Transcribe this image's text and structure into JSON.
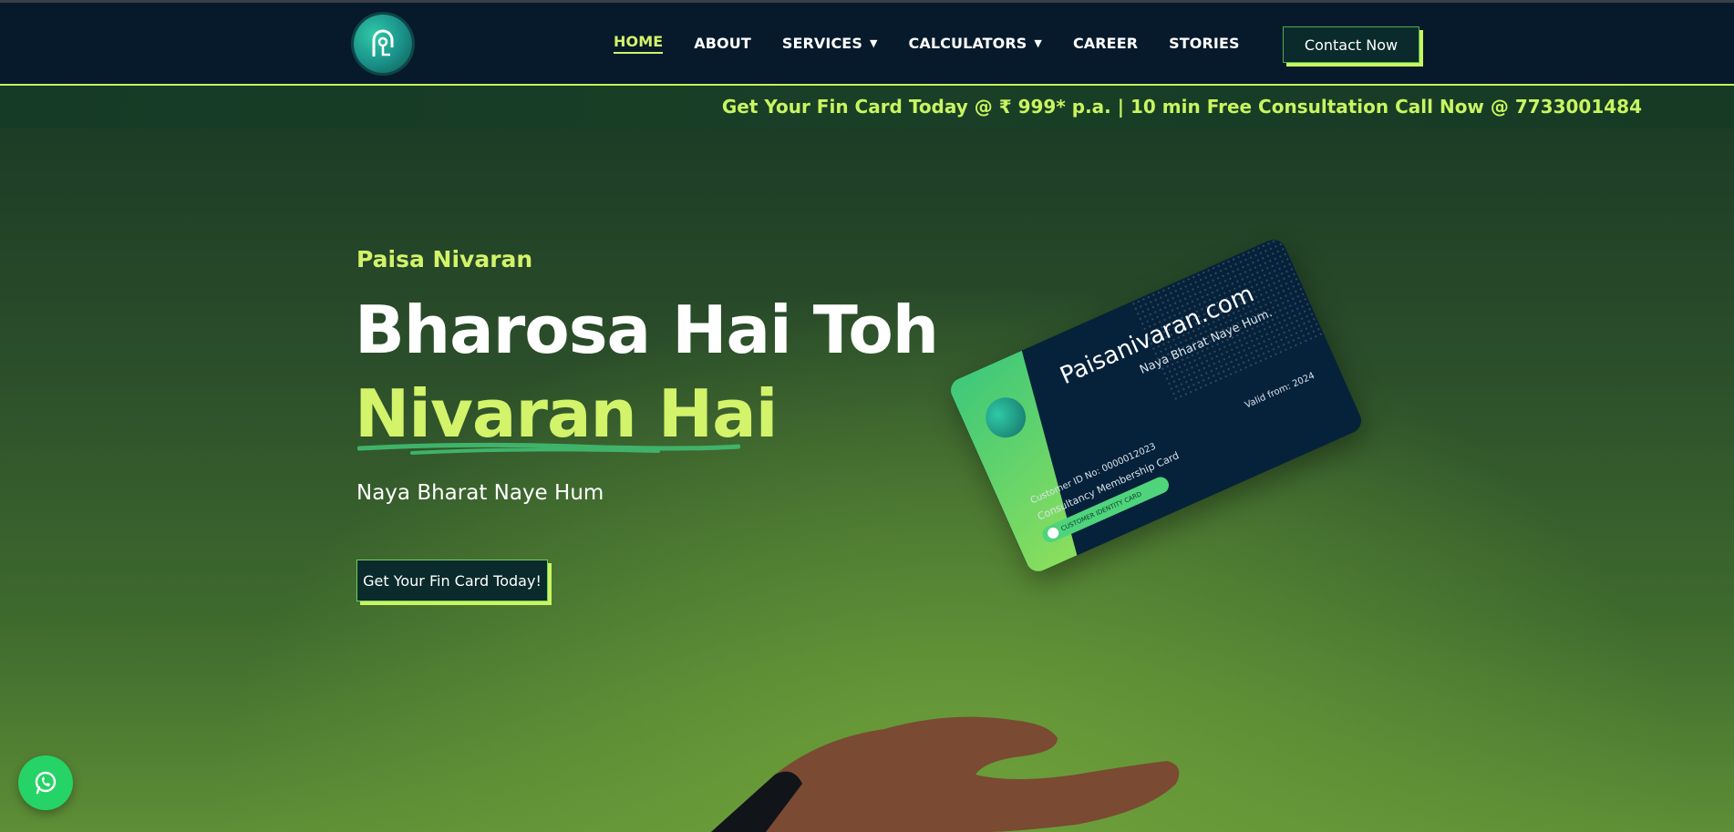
{
  "nav": {
    "items": [
      {
        "label": "HOME",
        "active": true,
        "dropdown": false
      },
      {
        "label": "ABOUT",
        "active": false,
        "dropdown": false
      },
      {
        "label": "SERVICES",
        "active": false,
        "dropdown": true
      },
      {
        "label": "CALCULATORS",
        "active": false,
        "dropdown": true
      },
      {
        "label": "CAREER",
        "active": false,
        "dropdown": false
      },
      {
        "label": "STORIES",
        "active": false,
        "dropdown": false
      }
    ],
    "contact_label": "Contact Now"
  },
  "ticker": {
    "text": "Get Your Fin Card Today @ ₹ 999* p.a. | 10 min Free Consultation Call Now @ 7733001484"
  },
  "hero": {
    "eyebrow": "Paisa Nivaran",
    "headline_line1": "Bharosa Hai Toh",
    "headline_line2": "Nivaran Hai",
    "tagline": "Naya Bharat Naye Hum",
    "cta_label": "Get Your Fin Card Today!"
  },
  "card": {
    "site": "Paisanivaran.com",
    "tagline": "Naya Bharat Naye Hum.",
    "customer_id": "Customer ID No: 0000012023",
    "card_type": "Consultancy Membership Card",
    "pill_label": "CUSTOMER IDENTITY CARD",
    "valid": "Valid from: 2024"
  },
  "colors": {
    "accent": "#d2f36a",
    "navbar_bg": "#061a2b",
    "hero_green": "#3f6a2e",
    "whatsapp": "#25d366"
  },
  "icons": {
    "logo": "house-key-logo",
    "whatsapp": "whatsapp-icon",
    "dropdown": "caret-down-icon"
  }
}
